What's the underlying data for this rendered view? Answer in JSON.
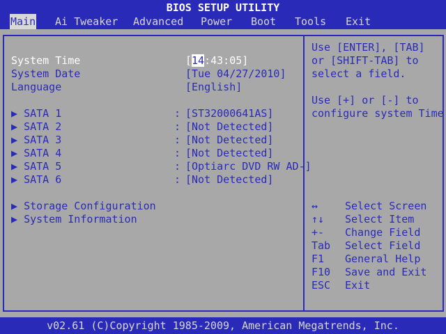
{
  "title": "BIOS SETUP UTILITY",
  "menu": {
    "items": [
      {
        "label": "Main"
      },
      {
        "label": "Ai Tweaker"
      },
      {
        "label": "Advanced"
      },
      {
        "label": "Power"
      },
      {
        "label": "Boot"
      },
      {
        "label": "Tools"
      },
      {
        "label": "Exit"
      }
    ]
  },
  "main": {
    "system_time": {
      "label": "System Time",
      "open": "[",
      "cursor": "14",
      "rest": ":43:05]"
    },
    "system_date": {
      "label": "System Date",
      "value": "[Tue 04/27/2010]"
    },
    "language": {
      "label": "Language",
      "value": "[English]"
    },
    "sata": [
      {
        "label": "SATA 1",
        "value": "[ST32000641AS]"
      },
      {
        "label": "SATA 2",
        "value": "[Not Detected]"
      },
      {
        "label": "SATA 3",
        "value": "[Not Detected]"
      },
      {
        "label": "SATA 4",
        "value": "[Not Detected]"
      },
      {
        "label": "SATA 5",
        "value": "[Optiarc DVD RW AD-]"
      },
      {
        "label": "SATA 6",
        "value": "[Not Detected]"
      }
    ],
    "submenus": [
      {
        "label": "Storage Configuration"
      },
      {
        "label": "System Information"
      }
    ],
    "arrow": "▶",
    "separator": ":"
  },
  "help": {
    "lines1": [
      "Use [ENTER], [TAB]",
      "or [SHIFT-TAB] to",
      "select a field."
    ],
    "lines2": [
      "Use [+] or [-] to",
      "configure system Time."
    ],
    "keys": [
      {
        "key": "↔",
        "desc": "Select Screen"
      },
      {
        "key": "↑↓",
        "desc": "Select Item"
      },
      {
        "key": "+-",
        "desc": "Change Field"
      },
      {
        "key": "Tab",
        "desc": "Select Field"
      },
      {
        "key": "F1",
        "desc": "General Help"
      },
      {
        "key": "F10",
        "desc": "Save and Exit"
      },
      {
        "key": "ESC",
        "desc": "Exit"
      }
    ]
  },
  "footer": "v02.61 (C)Copyright 1985-2009, American Megatrends, Inc.",
  "colors": {
    "background": "#a8a8a8",
    "bar": "#2a2ab8",
    "highlight": "#ffffff"
  }
}
